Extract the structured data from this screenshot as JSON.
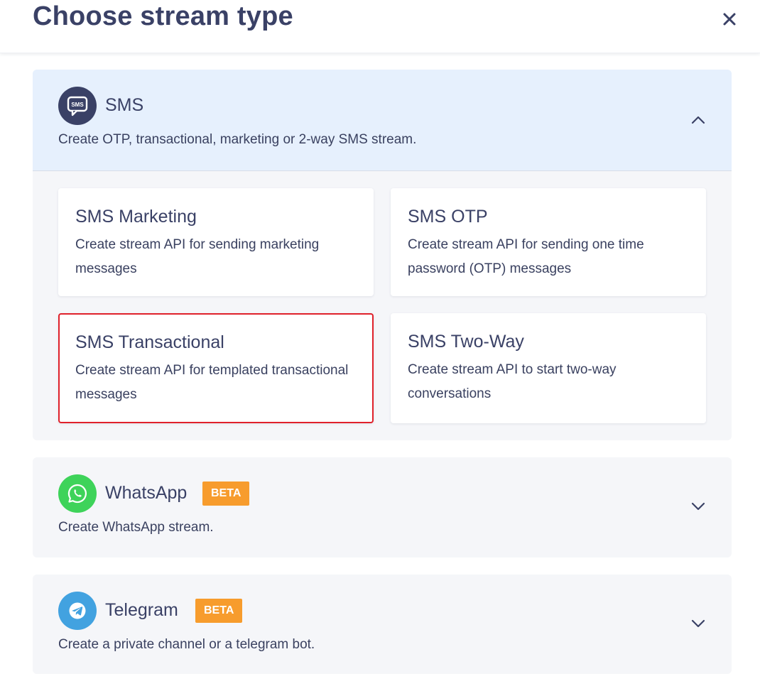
{
  "dialog": {
    "title": "Choose stream type",
    "close_label": "close"
  },
  "sections": [
    {
      "name": "SMS",
      "description": "Create OTP, transactional, marketing or 2-way SMS stream.",
      "icon": "sms-icon",
      "expanded": true,
      "color": "#3a4166",
      "cards": [
        {
          "title": "SMS Marketing",
          "description": "Create stream API for sending marketing messages",
          "selected": false
        },
        {
          "title": "SMS OTP",
          "description": "Create stream API for sending one time password (OTP) messages",
          "selected": false
        },
        {
          "title": "SMS Transactional",
          "description": "Create stream API for templated transactional messages",
          "selected": true
        },
        {
          "title": "SMS Two-Way",
          "description": "Create stream API to start two-way conversations",
          "selected": false
        }
      ]
    },
    {
      "name": "WhatsApp",
      "badge": "BETA",
      "description": "Create WhatsApp stream.",
      "icon": "whatsapp-icon",
      "expanded": false,
      "color": "#3ed35a"
    },
    {
      "name": "Telegram",
      "badge": "BETA",
      "description": "Create a private channel or a telegram bot.",
      "icon": "telegram-icon",
      "expanded": false,
      "color": "#42a2e0"
    }
  ],
  "colors": {
    "selected_border": "#e0212b",
    "beta_badge": "#f79c2d",
    "expanded_header": "#e6f0fd"
  }
}
